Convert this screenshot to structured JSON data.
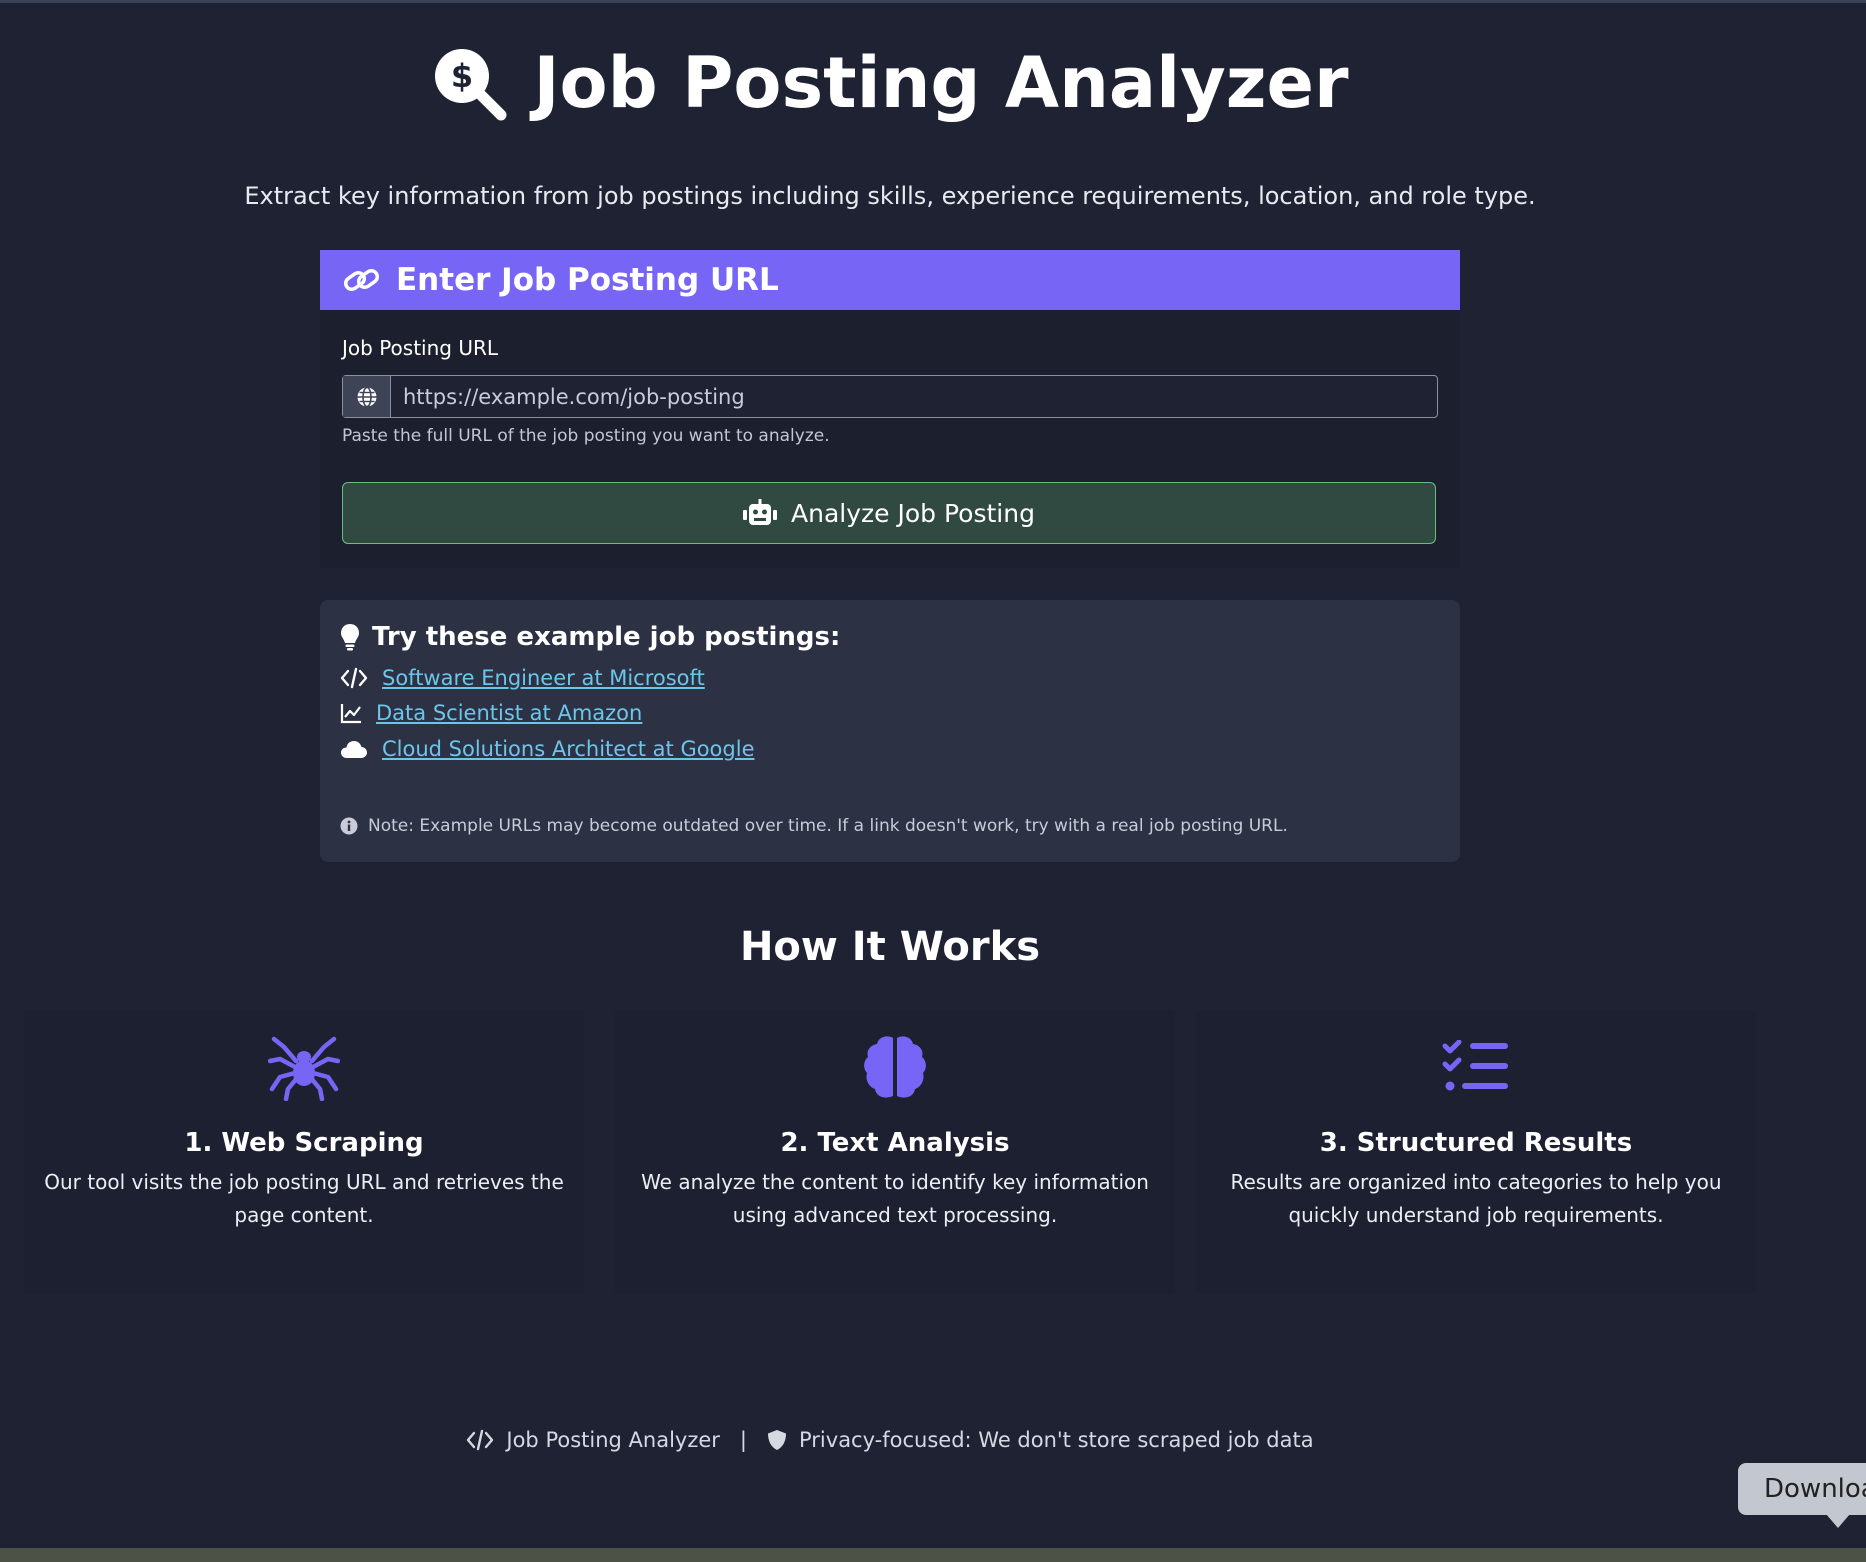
{
  "header": {
    "title": "Job Posting Analyzer",
    "subtitle": "Extract key information from job postings including skills, experience requirements, location, and role type.",
    "icon": "search-dollar-icon"
  },
  "url_card": {
    "heading": "Enter Job Posting URL",
    "heading_icon": "link-icon",
    "field_label": "Job Posting URL",
    "input_placeholder": "https://example.com/job-posting",
    "input_value": "",
    "input_icon": "globe-icon",
    "help_text": "Paste the full URL of the job posting you want to analyze.",
    "button_label": "Analyze Job Posting",
    "button_icon": "robot-icon"
  },
  "examples": {
    "heading": "Try these example job postings:",
    "heading_icon": "lightbulb-icon",
    "items": [
      {
        "label": "Software Engineer at Microsoft",
        "icon": "code-icon"
      },
      {
        "label": "Data Scientist at Amazon",
        "icon": "chart-line-icon"
      },
      {
        "label": "Cloud Solutions Architect at Google",
        "icon": "cloud-icon"
      }
    ],
    "note": "Note: Example URLs may become outdated over time. If a link doesn't work, try with a real job posting URL.",
    "note_icon": "info-icon"
  },
  "how_it_works": {
    "heading": "How It Works",
    "steps": [
      {
        "title": "1. Web Scraping",
        "description": "Our tool visits the job posting URL and retrieves the page content.",
        "icon": "spider-icon"
      },
      {
        "title": "2. Text Analysis",
        "description": "We analyze the content to identify key information using advanced text processing.",
        "icon": "brain-icon"
      },
      {
        "title": "3. Structured Results",
        "description": "Results are organized into categories to help you quickly understand job requirements.",
        "icon": "list-check-icon"
      }
    ]
  },
  "footer": {
    "app_name": "Job Posting Analyzer",
    "separator": "|",
    "privacy_text": "Privacy-focused: We don't store scraped job data"
  },
  "tooltip": {
    "text": "Download"
  },
  "colors": {
    "background": "#1e2233",
    "accent": "#7766f5",
    "button_bg": "#304a42",
    "button_border": "#65c080",
    "link": "#6cc6ea",
    "panel": "#2c3143"
  }
}
